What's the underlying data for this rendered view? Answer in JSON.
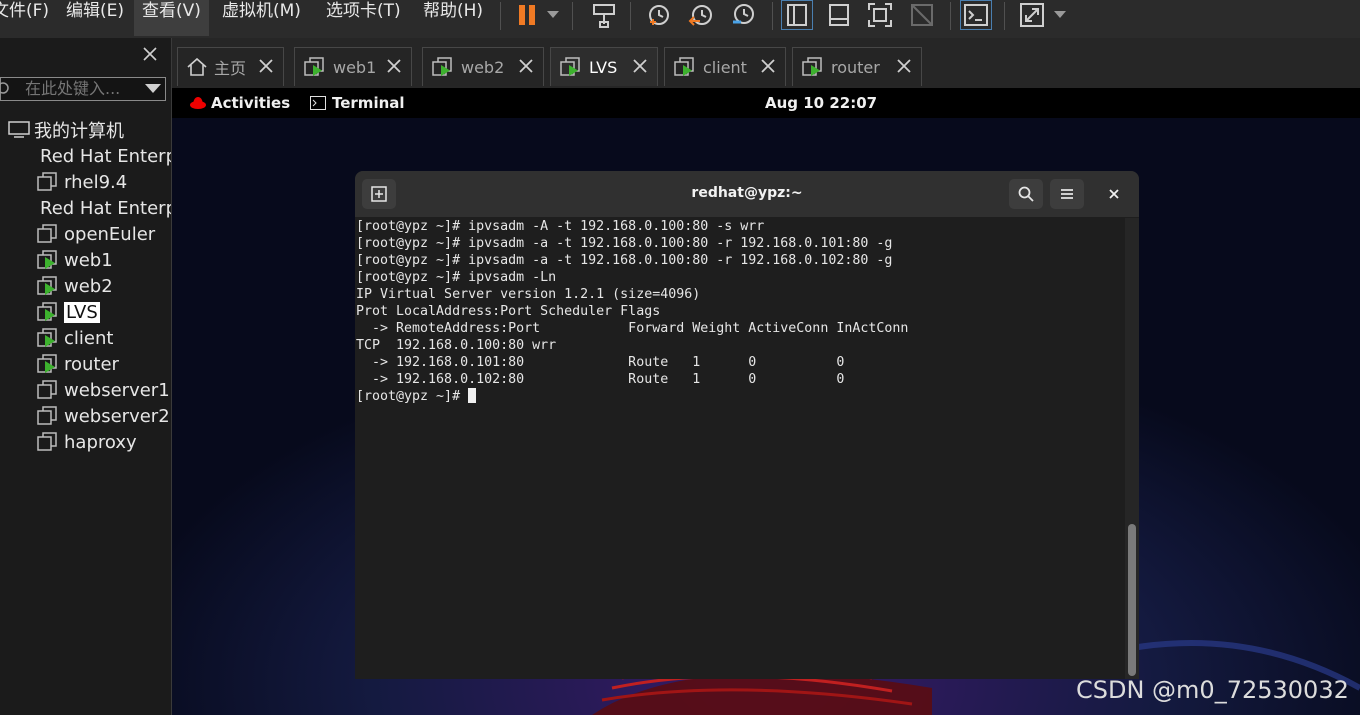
{
  "menu": [
    "文件(F)",
    "编辑(E)",
    "查看(V)",
    "虚拟机(M)",
    "选项卡(T)",
    "帮助(H)"
  ],
  "sidebar": {
    "search_placeholder": "在此处键入...",
    "root": "我的计算机",
    "items": [
      {
        "label": "Red Hat Enterprise Linux",
        "running": false
      },
      {
        "label": "rhel9.4",
        "running": false
      },
      {
        "label": "Red Hat Enterprise Linux",
        "running": false
      },
      {
        "label": "openEuler",
        "running": false
      },
      {
        "label": "web1",
        "running": true
      },
      {
        "label": "web2",
        "running": true
      },
      {
        "label": "LVS",
        "running": true,
        "selected": true
      },
      {
        "label": "client",
        "running": true
      },
      {
        "label": "router",
        "running": true
      },
      {
        "label": "webserver1",
        "running": false
      },
      {
        "label": "webserver2",
        "running": false
      },
      {
        "label": "haproxy",
        "running": false
      }
    ]
  },
  "tabs": [
    {
      "label": "主页",
      "icon": "home-icon"
    },
    {
      "label": "web1",
      "icon": "vm-running-icon"
    },
    {
      "label": "web2",
      "icon": "vm-running-icon"
    },
    {
      "label": "LVS",
      "icon": "vm-running-icon",
      "active": true
    },
    {
      "label": "client",
      "icon": "vm-running-icon"
    },
    {
      "label": "router",
      "icon": "vm-running-icon"
    }
  ],
  "guest": {
    "activities": "Activities",
    "app": "Terminal",
    "clock": "Aug 10  22:07"
  },
  "terminal": {
    "title": "redhat@ypz:~",
    "lines": [
      "[root@ypz ~]# ipvsadm -A -t 192.168.0.100:80 -s wrr",
      "[root@ypz ~]# ipvsadm -a -t 192.168.0.100:80 -r 192.168.0.101:80 -g",
      "[root@ypz ~]# ipvsadm -a -t 192.168.0.100:80 -r 192.168.0.102:80 -g",
      "[root@ypz ~]# ipvsadm -Ln",
      "IP Virtual Server version 1.2.1 (size=4096)",
      "Prot LocalAddress:Port Scheduler Flags",
      "  -> RemoteAddress:Port           Forward Weight ActiveConn InActConn",
      "TCP  192.168.0.100:80 wrr",
      "  -> 192.168.0.101:80             Route   1      0          0",
      "  -> 192.168.0.102:80             Route   1      0          0"
    ],
    "prompt": "[root@ypz ~]# "
  },
  "watermark": "CSDN @m0_72530032",
  "colors": {
    "pause_orange": "#f07a24",
    "play_green": "#3db22e",
    "redhat_red": "#ee0000"
  }
}
